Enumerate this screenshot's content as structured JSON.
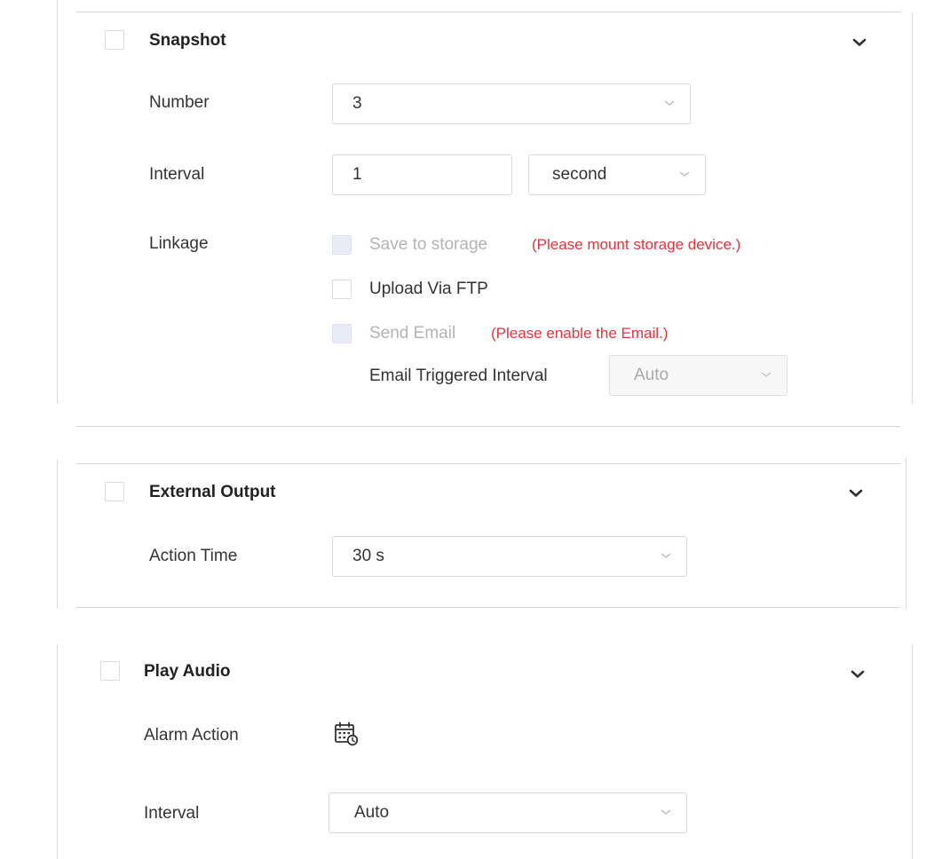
{
  "snapshot": {
    "title": "Snapshot",
    "number_label": "Number",
    "number_value": "3",
    "interval_label": "Interval",
    "interval_value": "1",
    "interval_unit": "second",
    "linkage_label": "Linkage",
    "save_to_storage": "Save to storage",
    "storage_warning": "(Please mount storage device.)",
    "upload_ftp": "Upload Via FTP",
    "send_email": "Send Email",
    "email_warning": "(Please enable the Email.)",
    "email_interval_label": "Email Triggered Interval",
    "email_interval_value": "Auto"
  },
  "external_output": {
    "title": "External Output",
    "action_time_label": "Action Time",
    "action_time_value": "30 s"
  },
  "play_audio": {
    "title": "Play Audio",
    "alarm_action_label": "Alarm Action",
    "alarm_action_icon": "calendar-schedule-icon",
    "interval_label": "Interval",
    "interval_value": "Auto"
  },
  "colors": {
    "warning": "#e8323c",
    "border": "#d9d9d9",
    "disabled_checkbox": "#e9ecf6"
  }
}
